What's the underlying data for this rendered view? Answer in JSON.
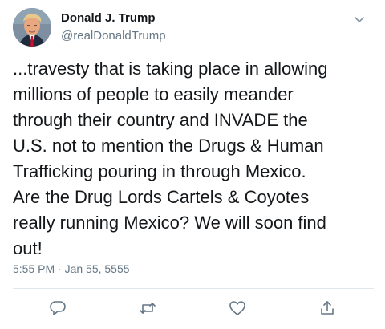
{
  "tweet": {
    "author_name": "Donald J. Trump",
    "handle": "@realDonaldTrump",
    "text": "...travesty that is taking place in allowing\nmillions of people to easily meander\nthrough their country and INVADE the\nU.S. not to mention the Drugs & Human\nTrafficking pouring in through Mexico.\nAre the Drug Lords Cartels & Coyotes\nreally running Mexico? We will soon find\nout!",
    "timestamp": "5:55 PM · Jan 55, 5555"
  },
  "icons": {
    "menu": "chevron-down-icon",
    "reply": "reply-icon",
    "retweet": "retweet-icon",
    "like": "heart-icon",
    "share": "share-icon"
  },
  "colors": {
    "text": "#14171a",
    "secondary": "#657786",
    "divider": "#e1e8ed"
  }
}
